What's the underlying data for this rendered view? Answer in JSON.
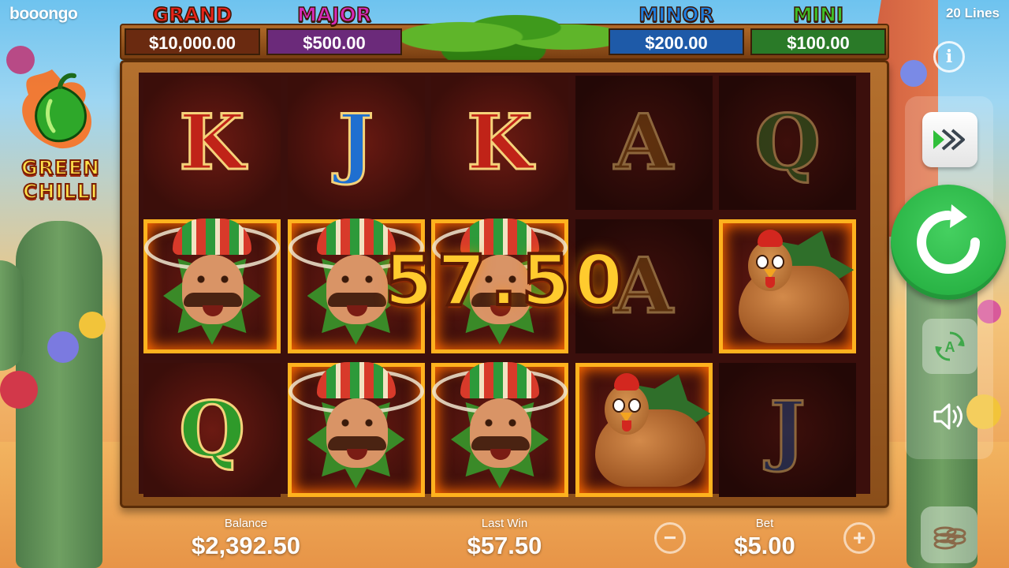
{
  "brand": "booongo",
  "lines_label": "20 Lines",
  "game_logo": {
    "line1": "GREEN",
    "line2": "CHILLI"
  },
  "jackpots": [
    {
      "name": "GRAND",
      "value": "$10,000.00",
      "name_color": "#e8241a",
      "box_color": "#6a2a10"
    },
    {
      "name": "MAJOR",
      "value": "$500.00",
      "name_color": "#d62ab8",
      "box_color": "#6b2a7a"
    },
    {
      "name": "MINOR",
      "value": "$200.00",
      "name_color": "#1f7fe0",
      "box_color": "#1e5aa8"
    },
    {
      "name": "MINI",
      "value": "$100.00",
      "name_color": "#3fbf2a",
      "box_color": "#2a7a28"
    }
  ],
  "reels": {
    "rows": [
      [
        {
          "type": "letter",
          "symbol": "K",
          "color": "#c02318",
          "state": "normal"
        },
        {
          "type": "letter",
          "symbol": "J",
          "color": "#1f6fd0",
          "state": "normal"
        },
        {
          "type": "letter",
          "symbol": "K",
          "color": "#c02318",
          "state": "normal"
        },
        {
          "type": "letter",
          "symbol": "A",
          "color": "#8a5a14",
          "state": "dim"
        },
        {
          "type": "letter",
          "symbol": "Q",
          "color": "#2f7a2a",
          "state": "dim"
        }
      ],
      [
        {
          "type": "mexican",
          "symbol": "mexican-man",
          "state": "win"
        },
        {
          "type": "mexican",
          "symbol": "mexican-man",
          "state": "win"
        },
        {
          "type": "mexican",
          "symbol": "mexican-man",
          "state": "win"
        },
        {
          "type": "letter",
          "symbol": "A",
          "color": "#8a5a14",
          "state": "dim"
        },
        {
          "type": "chicken",
          "symbol": "chicken",
          "state": "win"
        }
      ],
      [
        {
          "type": "letter",
          "symbol": "Q",
          "color": "#2f9a2a",
          "state": "normal"
        },
        {
          "type": "mexican",
          "symbol": "mexican-man",
          "state": "win"
        },
        {
          "type": "mexican",
          "symbol": "mexican-man",
          "state": "win"
        },
        {
          "type": "chicken",
          "symbol": "chicken",
          "state": "win"
        },
        {
          "type": "letter",
          "symbol": "J",
          "color": "#1f4f90",
          "state": "dim"
        }
      ]
    ]
  },
  "win_display": "57.50",
  "stats": {
    "balance_label": "Balance",
    "balance_value": "$2,392.50",
    "last_win_label": "Last Win",
    "last_win_value": "$57.50",
    "bet_label": "Bet",
    "bet_value": "$5.00"
  },
  "controls": {
    "info_glyph": "i",
    "auto_glyph": "A",
    "minus_glyph": "−",
    "plus_glyph": "+"
  }
}
